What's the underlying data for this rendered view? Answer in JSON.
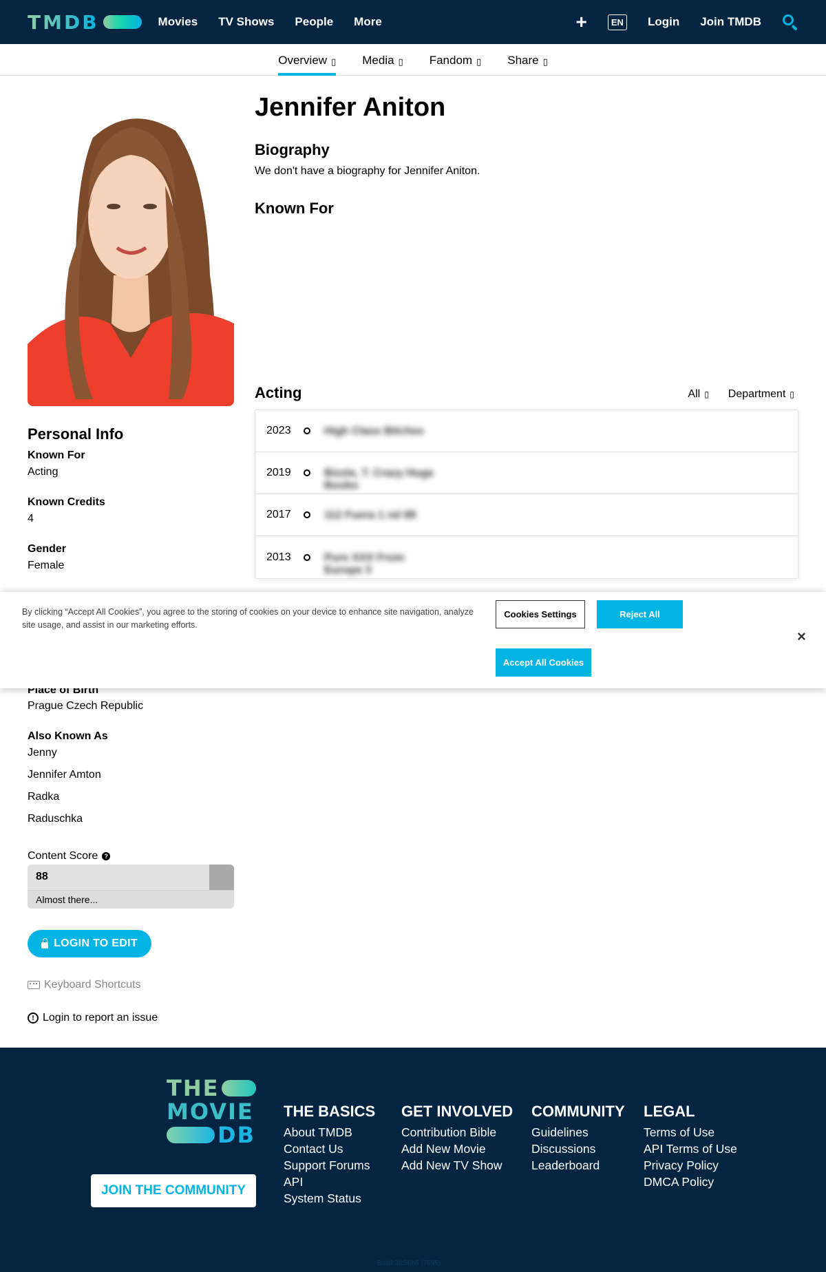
{
  "header": {
    "logo_text": "TMDB",
    "nav": [
      "Movies",
      "TV Shows",
      "People",
      "More"
    ],
    "lang": "EN",
    "login": "Login",
    "join": "Join TMDB"
  },
  "subnav": {
    "tabs": [
      {
        "label": "Overview",
        "chev": "▯"
      },
      {
        "label": "Media",
        "chev": "▯"
      },
      {
        "label": "Fandom",
        "chev": "▯"
      },
      {
        "label": "Share",
        "chev": "▯"
      }
    ]
  },
  "person": {
    "name": "Jennifer Aniton",
    "biography_title": "Biography",
    "biography": "We don't have a biography for Jennifer Aniton.",
    "known_for_title": "Known For"
  },
  "acting": {
    "title": "Acting",
    "filter_all": "All",
    "filter_department": "Department",
    "filter_chev": "▯",
    "credits": [
      {
        "year": "2023",
        "title": "High Class Bitches"
      },
      {
        "year": "2019",
        "title": "Bizzle, T. Crazy Huge Boobs"
      },
      {
        "year": "2017",
        "title": "112 Fuera 1 nd 88"
      },
      {
        "year": "2013",
        "title": "Pure XXX From Europe 3"
      }
    ]
  },
  "personal_info": {
    "title": "Personal Info",
    "known_for_label": "Known For",
    "known_for_value": "Acting",
    "credits_label": "Known Credits",
    "credits_value": "4",
    "gender_label": "Gender",
    "gender_value": "Female",
    "birth_label": "Place of Birth",
    "birth_value": "Prague Czech Republic",
    "aka_label": "Also Known As",
    "aka": [
      "Jenny",
      "Jennifer Amton",
      "Radka",
      "Raduschka"
    ]
  },
  "cookie": {
    "text": "By clicking “Accept All Cookies”, you agree to the storing of cookies on your device to enhance site navigation, analyze site usage, and assist in our marketing efforts.",
    "settings": "Cookies Settings",
    "reject": "Reject All",
    "accept": "Accept All Cookies",
    "close": "×"
  },
  "content_score": {
    "label": "Content Score",
    "help": "?",
    "value": "88",
    "percent": 88,
    "note": "Almost there..."
  },
  "actions": {
    "login_edit": "LOGIN TO EDIT",
    "keyboard": "Keyboard Shortcuts",
    "report": "Login to report an issue"
  },
  "footer": {
    "logo": [
      "THE",
      "MOVIE",
      "DB"
    ],
    "join": "JOIN THE COMMUNITY",
    "columns": [
      {
        "title": "The Basics",
        "links": [
          "About TMDB",
          "Contact Us",
          "Support Forums",
          "API",
          "System Status"
        ]
      },
      {
        "title": "Get Involved",
        "links": [
          "Contribution Bible",
          "Add New Movie",
          "Add New TV Show"
        ]
      },
      {
        "title": "Community",
        "links": [
          "Guidelines",
          "Discussions",
          "Leaderboard"
        ]
      },
      {
        "title": "Legal",
        "links": [
          "Terms of Use",
          "API Terms of Use",
          "Privacy Policy",
          "DMCA Policy"
        ]
      }
    ],
    "build": "Build 3fc56b6 (7695)"
  },
  "colors": {
    "navy": "#032541",
    "accent": "#01b4e4",
    "green": "#90cea1"
  }
}
